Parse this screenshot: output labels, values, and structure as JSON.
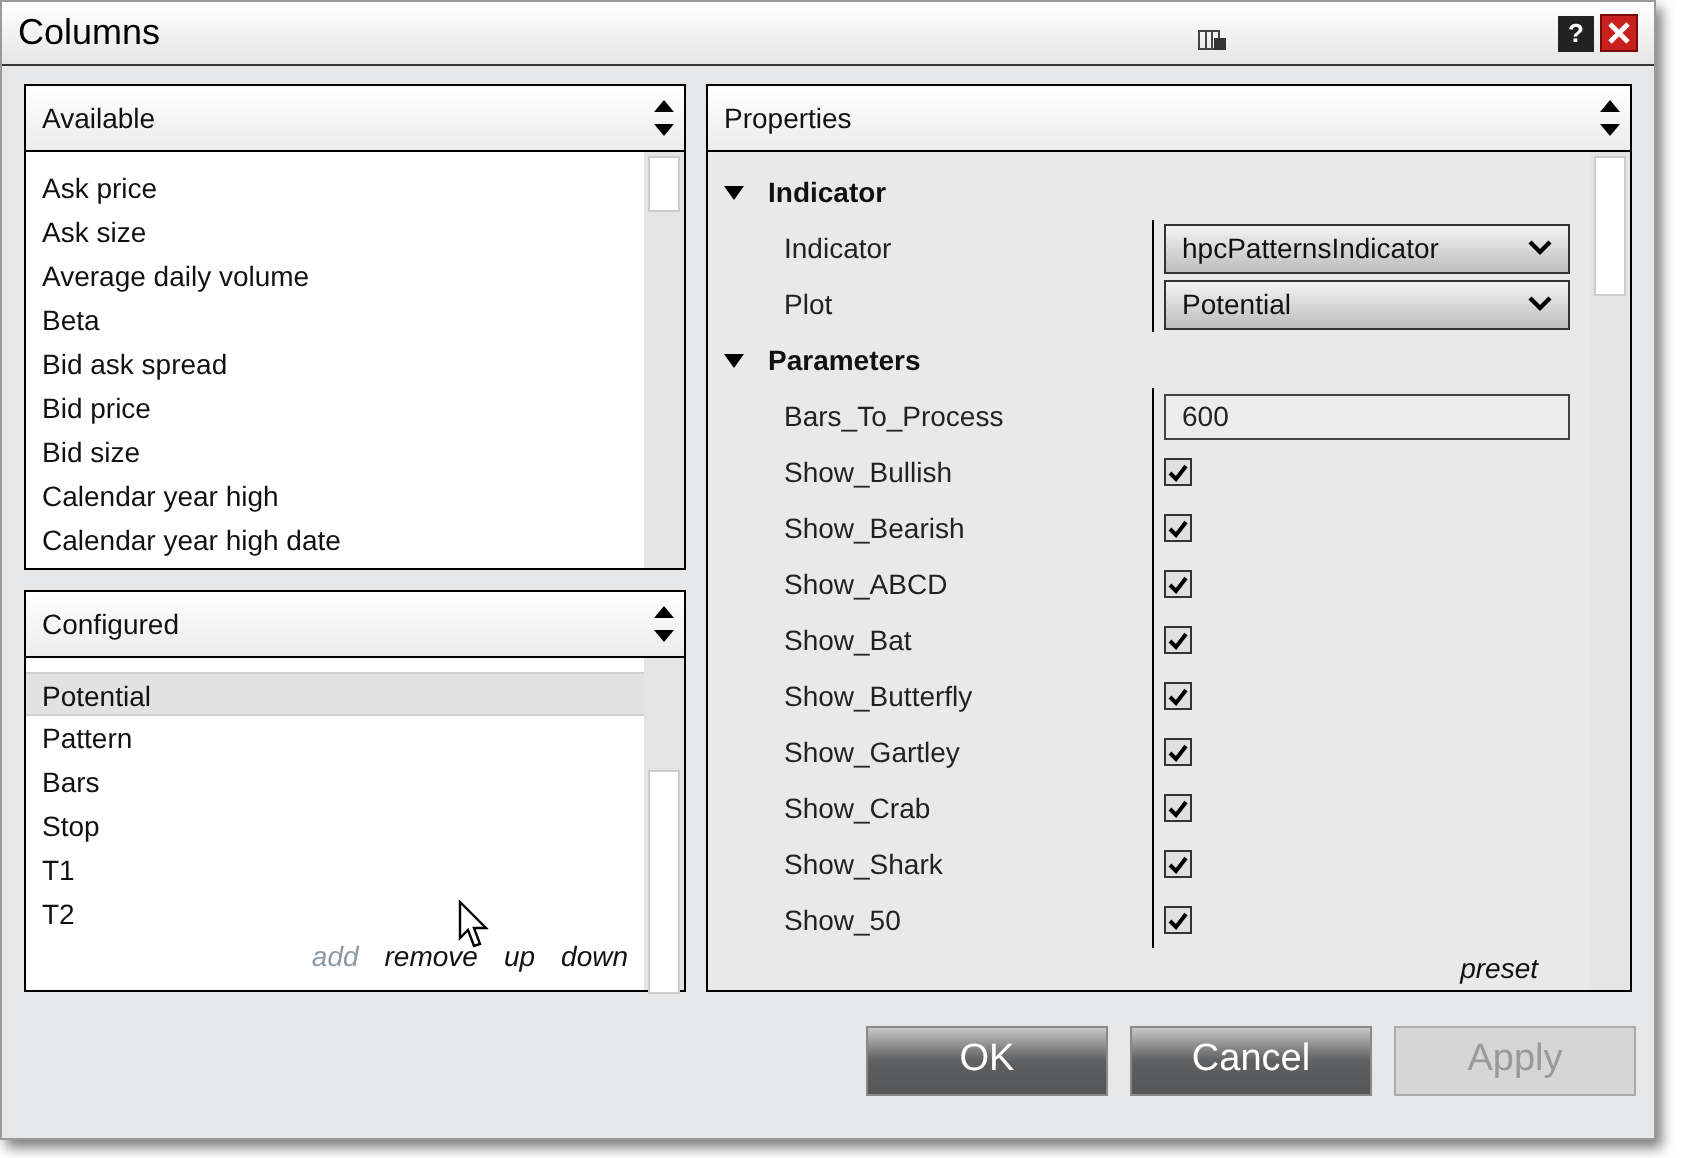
{
  "window": {
    "title": "Columns",
    "help_label": "?"
  },
  "available": {
    "title": "Available",
    "items": [
      "Ask price",
      "Ask size",
      "Average daily volume",
      "Beta",
      "Bid ask spread",
      "Bid price",
      "Bid size",
      "Calendar year high",
      "Calendar year high date"
    ]
  },
  "configured": {
    "title": "Configured",
    "items": [
      {
        "label": "Potential",
        "selected": true
      },
      {
        "label": "Pattern",
        "selected": false
      },
      {
        "label": "Bars",
        "selected": false
      },
      {
        "label": "Stop",
        "selected": false
      },
      {
        "label": "T1",
        "selected": false
      },
      {
        "label": "T2",
        "selected": false
      }
    ],
    "actions": [
      {
        "label": "add",
        "disabled": true
      },
      {
        "label": "remove",
        "disabled": false
      },
      {
        "label": "up",
        "disabled": false
      },
      {
        "label": "down",
        "disabled": false
      }
    ]
  },
  "properties": {
    "title": "Properties",
    "categories": [
      {
        "name": "Indicator",
        "expanded": true,
        "rows": [
          {
            "label": "Indicator",
            "kind": "dropdown",
            "value": "hpcPatternsIndicator"
          },
          {
            "label": "Plot",
            "kind": "dropdown",
            "value": "Potential"
          }
        ]
      },
      {
        "name": "Parameters",
        "expanded": true,
        "rows": [
          {
            "label": "Bars_To_Process",
            "kind": "text",
            "value": "600"
          },
          {
            "label": "Show_Bullish",
            "kind": "checkbox",
            "checked": true
          },
          {
            "label": "Show_Bearish",
            "kind": "checkbox",
            "checked": true
          },
          {
            "label": "Show_ABCD",
            "kind": "checkbox",
            "checked": true
          },
          {
            "label": "Show_Bat",
            "kind": "checkbox",
            "checked": true
          },
          {
            "label": "Show_Butterfly",
            "kind": "checkbox",
            "checked": true
          },
          {
            "label": "Show_Gartley",
            "kind": "checkbox",
            "checked": true
          },
          {
            "label": "Show_Crab",
            "kind": "checkbox",
            "checked": true
          },
          {
            "label": "Show_Shark",
            "kind": "checkbox",
            "checked": true
          },
          {
            "label": "Show_50",
            "kind": "checkbox",
            "checked": true
          }
        ]
      }
    ],
    "preset": "preset"
  },
  "buttons": [
    {
      "label": "OK",
      "disabled": false
    },
    {
      "label": "Cancel",
      "disabled": false
    },
    {
      "label": "Apply",
      "disabled": true
    }
  ]
}
